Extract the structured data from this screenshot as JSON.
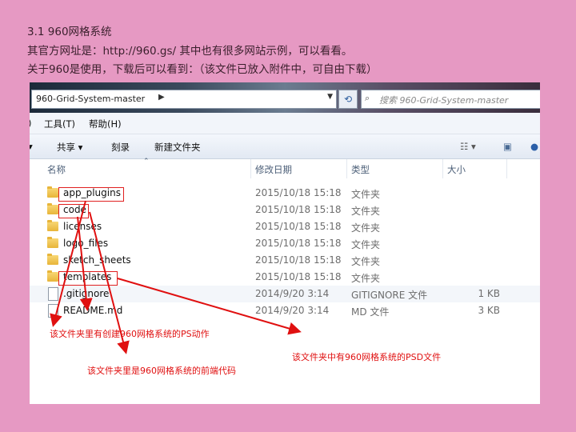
{
  "header": {
    "line1": "3.1  960网格系统",
    "line2": "其官方网址是：http://960.gs/     其中也有很多网站示例，可以看看。",
    "line3": "关于960是使用，下载后可以看到：（该文件已放入附件中，可自由下载）"
  },
  "address_bar": {
    "path": "960-Grid-System-master",
    "search_placeholder": "搜索 960-Grid-System-master"
  },
  "menu": {
    "tools": "工具(T)",
    "help": "帮助(H)"
  },
  "toolbar": {
    "share": "共享 ▾",
    "burn": "刻录",
    "new_folder": "新建文件夹"
  },
  "columns": {
    "name": "名称",
    "date": "修改日期",
    "type": "类型",
    "size": "大小"
  },
  "files": [
    {
      "name": "app_plugins",
      "date": "2015/10/18 15:18",
      "type": "文件夹",
      "size": "",
      "kind": "folder"
    },
    {
      "name": "code",
      "date": "2015/10/18 15:18",
      "type": "文件夹",
      "size": "",
      "kind": "folder"
    },
    {
      "name": "licenses",
      "date": "2015/10/18 15:18",
      "type": "文件夹",
      "size": "",
      "kind": "folder"
    },
    {
      "name": "logo_files",
      "date": "2015/10/18 15:18",
      "type": "文件夹",
      "size": "",
      "kind": "folder"
    },
    {
      "name": "sketch_sheets",
      "date": "2015/10/18 15:18",
      "type": "文件夹",
      "size": "",
      "kind": "folder"
    },
    {
      "name": "templates",
      "date": "2015/10/18 15:18",
      "type": "文件夹",
      "size": "",
      "kind": "folder"
    },
    {
      "name": ".gitignore",
      "date": "2014/9/20 3:14",
      "type": "GITIGNORE 文件",
      "size": "1 KB",
      "kind": "file"
    },
    {
      "name": "README.md",
      "date": "2014/9/20 3:14",
      "type": "MD 文件",
      "size": "3 KB",
      "kind": "file"
    }
  ],
  "annotations": {
    "a1": "该文件夹里有创建960网格系统的PS动作",
    "a2": "该文件夹里是960网格系统的前端代码",
    "a3": "该文件夹中有960网格系统的PSD文件"
  },
  "colors": {
    "background": "#e699c3",
    "annotation": "#e01010"
  }
}
